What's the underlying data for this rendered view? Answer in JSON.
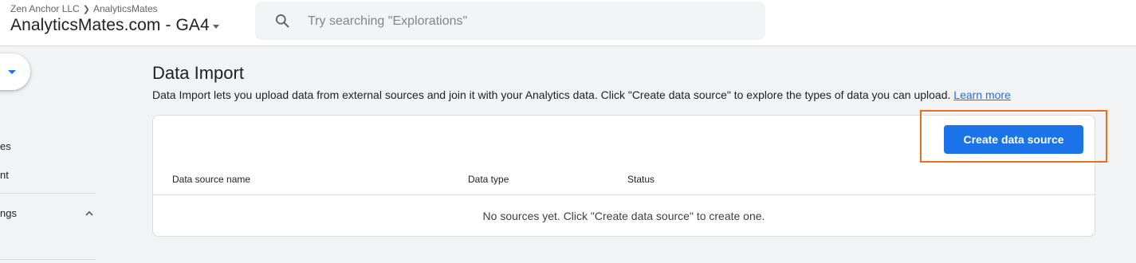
{
  "header": {
    "account": "Zen Anchor LLC",
    "property_crumb": "AnalyticsMates",
    "property_name": "AnalyticsMates.com - GA4"
  },
  "search": {
    "placeholder": "Try searching \"Explorations\""
  },
  "sidebar": {
    "items": [
      {
        "label": "es"
      },
      {
        "label": "nt"
      },
      {
        "label": "ngs"
      }
    ]
  },
  "main": {
    "title": "Data Import",
    "description": "Data Import lets you upload data from external sources and join it with your Analytics data. Click \"Create data source\" to explore the types of data you can upload.",
    "learn_more": "Learn more",
    "create_button": "Create data source",
    "table": {
      "columns": [
        "Data source name",
        "Data type",
        "Status"
      ],
      "empty_message": "No sources yet. Click \"Create data source\" to create one."
    }
  },
  "colors": {
    "accent": "#1a73e8",
    "highlight": "#e8711a"
  }
}
